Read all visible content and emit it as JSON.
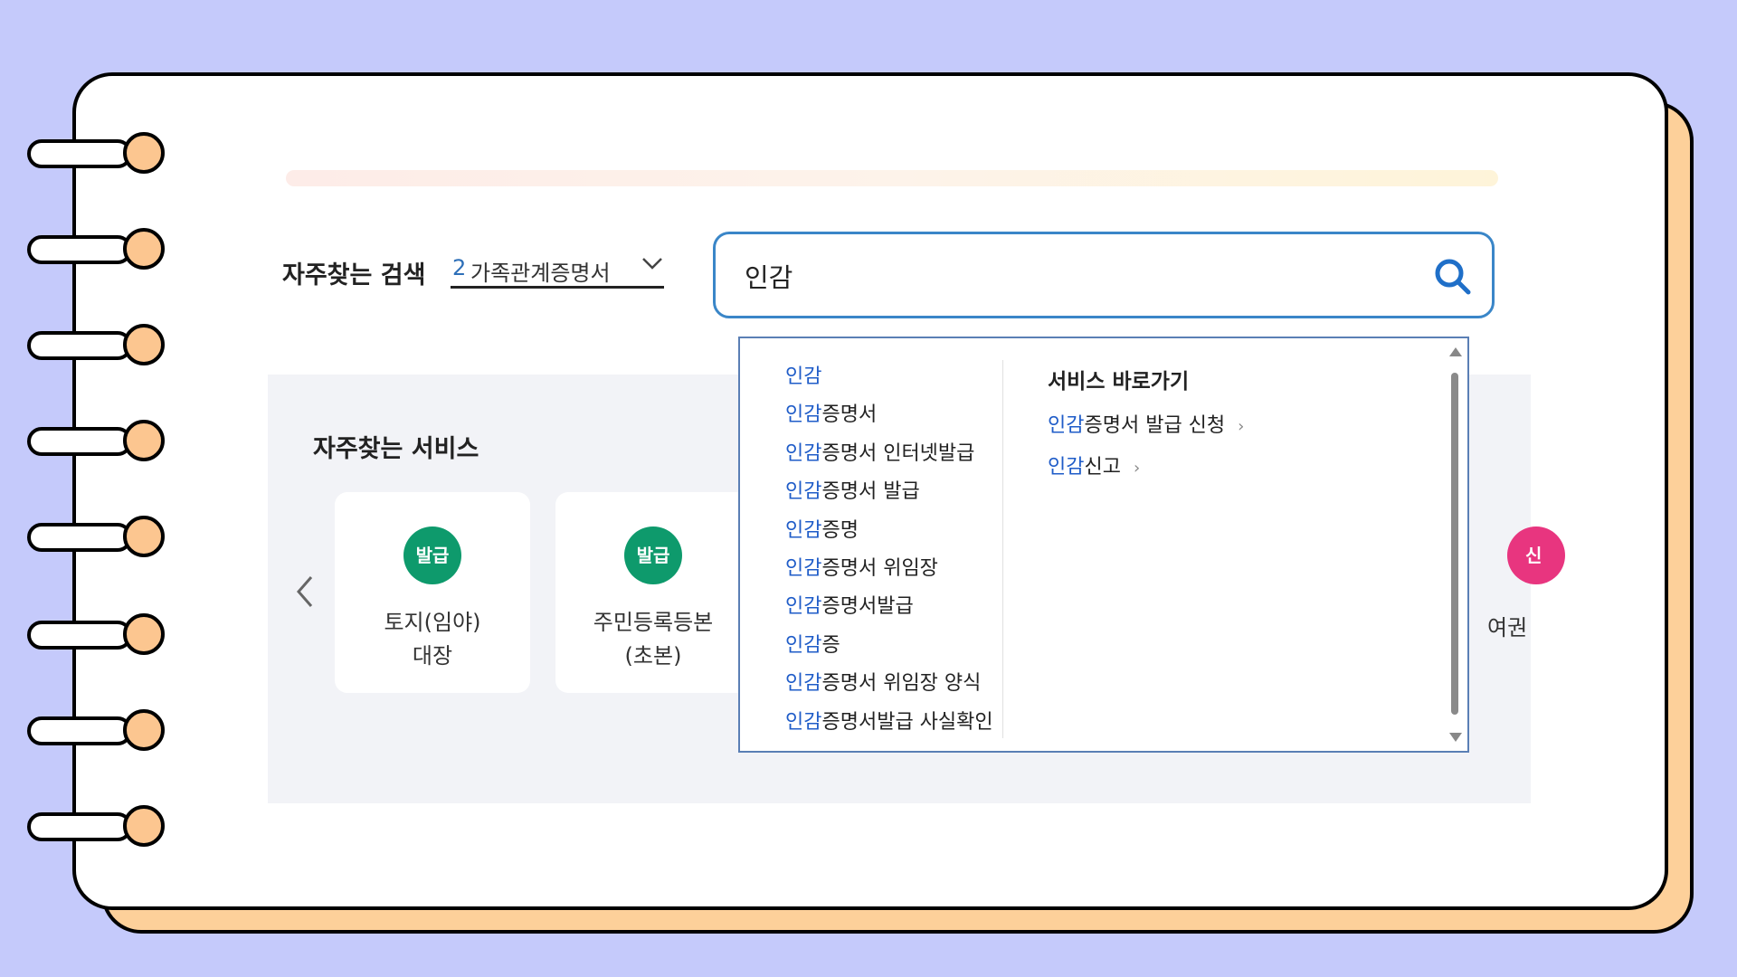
{
  "frequent_search": {
    "label": "자주찾는 검색",
    "rank": "2",
    "term": "가족관계증명서"
  },
  "search": {
    "value": "인감"
  },
  "autocomplete": {
    "highlight": "인감",
    "suggestions": [
      "",
      "증명서",
      "증명서 인터넷발급",
      "증명서 발급",
      "증명",
      "증명서 위임장",
      "증명서발급",
      "증",
      "증명서 위임장 양식",
      "증명서발급 사실확인"
    ],
    "quick_title": "서비스 바로가기",
    "quick_links": [
      "증명서 발급 신청",
      "신고"
    ]
  },
  "services": {
    "title": "자주찾는 서비스",
    "cards": [
      {
        "badge": "발급",
        "line1": "토지(임야)",
        "line2": "대장"
      },
      {
        "badge": "발급",
        "line1": "주민등록등본",
        "line2": "(초본)"
      }
    ],
    "partial_card": {
      "badge": "신",
      "name": "여권"
    }
  },
  "colors": {
    "background": "#c5cafb",
    "notebook_shadow": "#fdd09a",
    "accent_blue": "#3a86c8",
    "highlight_blue": "#1f5cc8",
    "badge_green": "#0e9a6c",
    "badge_pink": "#e8357f"
  }
}
